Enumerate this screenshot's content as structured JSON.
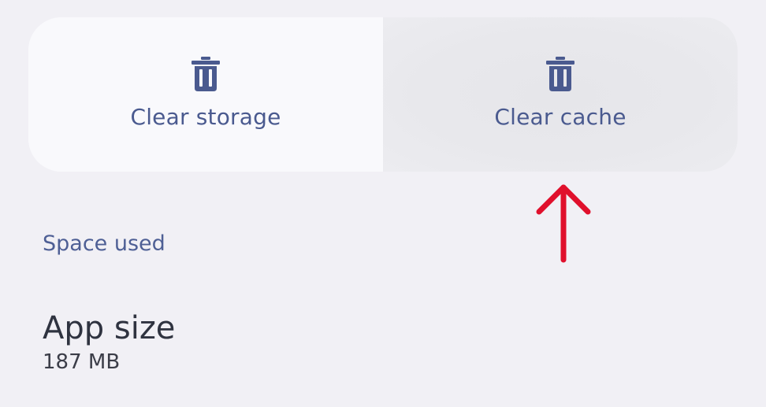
{
  "actions": {
    "clear_storage": {
      "label": "Clear storage",
      "icon": "trash-icon"
    },
    "clear_cache": {
      "label": "Clear cache",
      "icon": "trash-icon"
    }
  },
  "space_used": {
    "section_title": "Space used",
    "app_size": {
      "label": "App size",
      "value": "187 MB"
    }
  },
  "colors": {
    "background": "#f1f0f5",
    "card": "#f9f9fc",
    "pressed_card": "#e8e8ec",
    "accent": "#4a5a8f",
    "annotation": "#e0102c"
  },
  "annotation": {
    "icon": "arrow-up-icon"
  }
}
